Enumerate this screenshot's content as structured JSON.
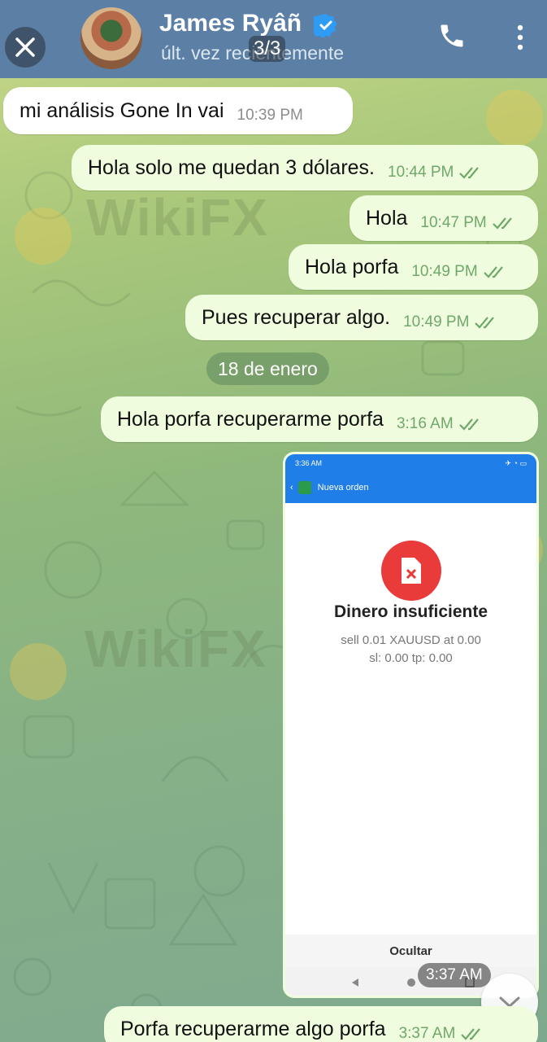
{
  "header": {
    "contact_name": "James Ryâñ",
    "last_seen": "últ. vez recientemente",
    "media_counter": "3/3"
  },
  "watermarks": [
    "WikiFX",
    "WikiFX"
  ],
  "messages": [
    {
      "text": "mi análisis Gone In vai",
      "time": "10:39 PM",
      "direction": "in"
    },
    {
      "text": "Hola solo me quedan 3 dólares.",
      "time": "10:44 PM",
      "direction": "out"
    },
    {
      "text": "Hola",
      "time": "10:47 PM",
      "direction": "out"
    },
    {
      "text": "Hola porfa",
      "time": "10:49 PM",
      "direction": "out"
    },
    {
      "text": "Pues recuperar algo.",
      "time": "10:49 PM",
      "direction": "out"
    },
    {
      "text": "Hola porfa recuperarme porfa",
      "time": "3:16 AM",
      "direction": "out"
    },
    {
      "text": "Porfa recuperarme algo porfa",
      "time": "3:37 AM",
      "direction": "out"
    }
  ],
  "date_separator": "18 de enero",
  "image_message": {
    "time": "3:37 AM",
    "phone_status_time": "3:36 AM",
    "app_title": "Nueva orden",
    "error_title": "Dinero insuficiente",
    "error_line1": "sell 0.01 XAUUSD at 0.00",
    "error_line2": "sl: 0.00 tp: 0.00",
    "hide_button": "Ocultar"
  },
  "colors": {
    "header_bg": "#5b7fa5",
    "outgoing_bubble": "#effdde",
    "incoming_bubble": "#ffffff",
    "read_ticks": "#6fa86a",
    "error_red": "#ea3b3b",
    "app_bar_blue": "#1f7ee8"
  },
  "icons": [
    "close-icon",
    "verified-badge-icon",
    "phone-call-icon",
    "more-vertical-icon",
    "double-check-icon",
    "chevron-down-icon",
    "file-error-icon"
  ]
}
